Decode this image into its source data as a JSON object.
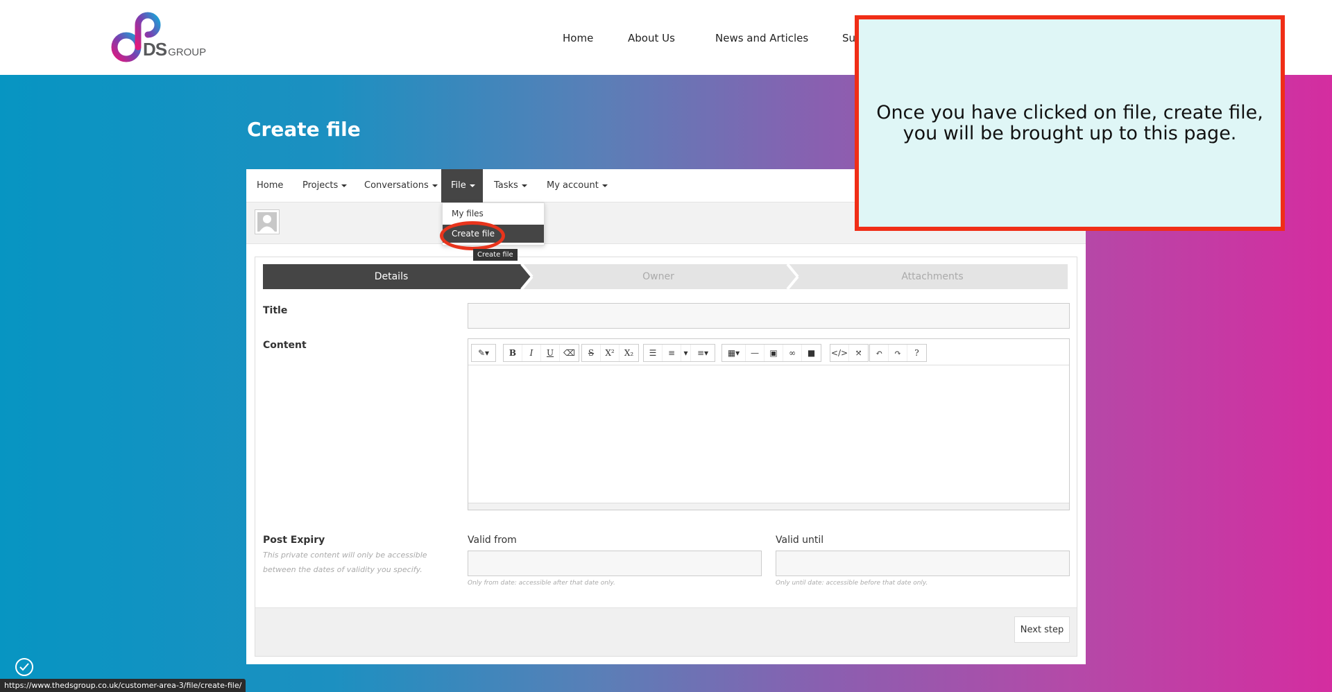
{
  "header": {
    "logo_text": "DS",
    "logo_sub": "GROUP",
    "nav": [
      "Home",
      "About Us",
      "News and Articles",
      "Su"
    ]
  },
  "page": {
    "title": "Create file"
  },
  "panel_nav": {
    "items": [
      {
        "label": "Home",
        "caret": false
      },
      {
        "label": "Projects",
        "caret": true
      },
      {
        "label": "Conversations",
        "caret": true
      },
      {
        "label": "File",
        "caret": true
      },
      {
        "label": "Tasks",
        "caret": true
      },
      {
        "label": "My account",
        "caret": true
      }
    ]
  },
  "dropdown": {
    "items": [
      "My files",
      "Create file"
    ],
    "tooltip": "Create file"
  },
  "steps": [
    "Details",
    "Owner",
    "Attachments"
  ],
  "form": {
    "title_label": "Title",
    "content_label": "Content",
    "post_expiry_label": "Post Expiry",
    "post_expiry_help_1": "This private content will only be accessible",
    "post_expiry_help_2": "between the dates of validity you specify.",
    "valid_from_label": "Valid from",
    "valid_until_label": "Valid until",
    "valid_from_help": "Only from date: accessible after that date only.",
    "valid_until_help": "Only until date: accessible before that date only.",
    "next_button": "Next step"
  },
  "callout": {
    "line1": "Once you have clicked on file, create file,",
    "line2": "you will be brought up to this page."
  },
  "status_url": "https://www.thedsgroup.co.uk/customer-area-3/file/create-file/",
  "colors": {
    "accent_dark": "#454545",
    "callout_border": "#f02e17",
    "callout_bg": "#dff6f6"
  }
}
